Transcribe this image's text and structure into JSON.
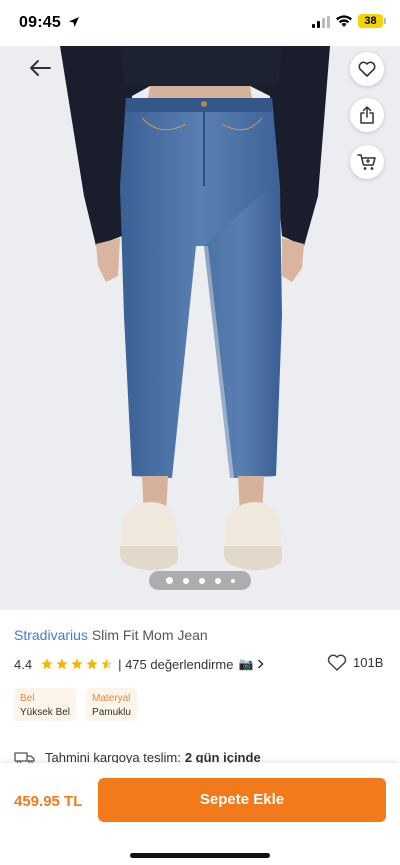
{
  "status_bar": {
    "time": "09:45",
    "battery": "38"
  },
  "product": {
    "brand": "Stradivarius",
    "name": "Slim Fit Mom Jean",
    "rating": "4.4",
    "reviews_text": "| 475 değerlendirme",
    "favorites": "101B",
    "attributes": [
      {
        "label": "Bel",
        "value": "Yüksek Bel"
      },
      {
        "label": "Materyal",
        "value": "Pamuklu"
      }
    ],
    "price": "459.95 TL"
  },
  "gallery": {
    "image_count": 5,
    "active_index": 0,
    "icon": "jeans-product-photo"
  },
  "shipping": {
    "text": "Tahmini kargoya teslim:",
    "days": "2 gün içinde"
  },
  "actions": {
    "add_to_cart_label": "Sepete Ekle"
  },
  "colors": {
    "accent": "#f27a1a",
    "brand_link": "#3f7fcf",
    "star": "#f5b400",
    "chip_bg": "#fdf4ea"
  }
}
